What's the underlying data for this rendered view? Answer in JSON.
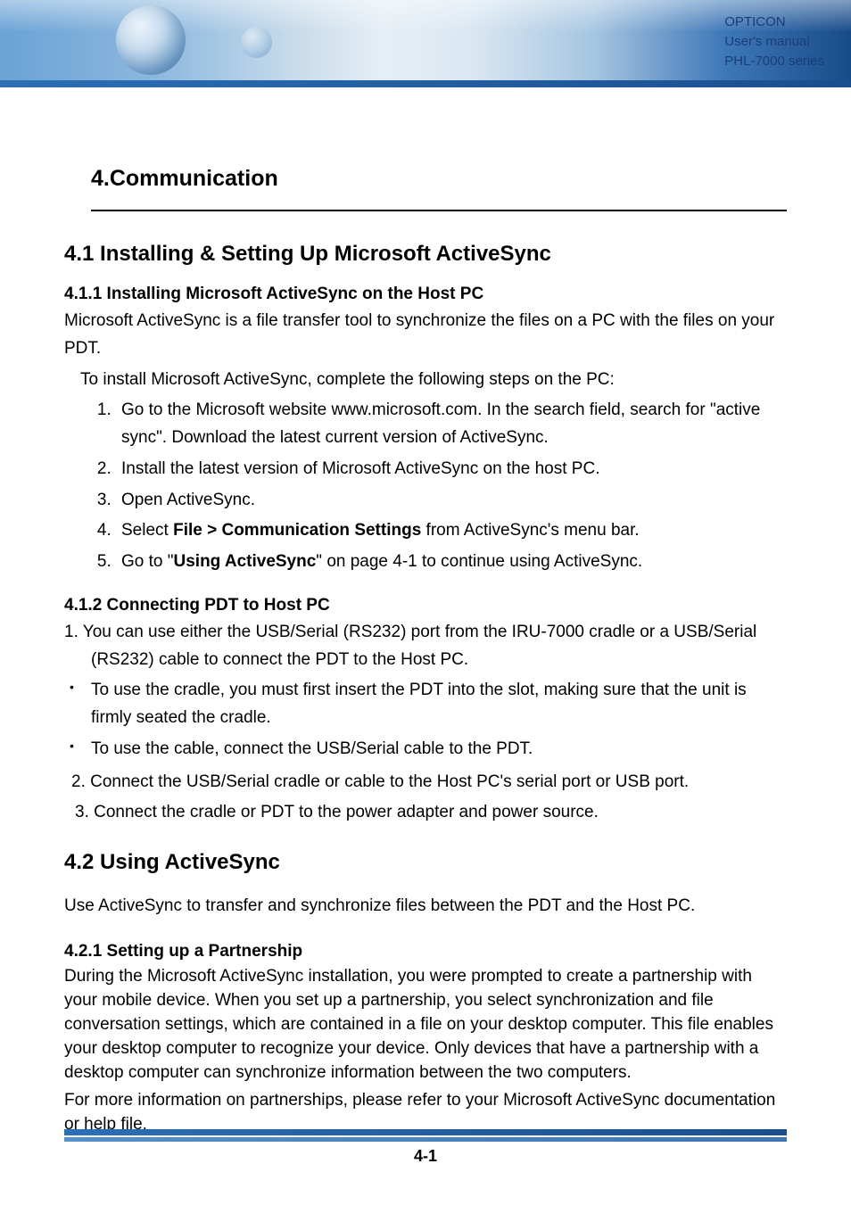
{
  "banner": {
    "line1": "OPTICON",
    "line2": "User's manual",
    "line3": "PHL-7000 series"
  },
  "chapter": {
    "title": "4.Communication"
  },
  "s41": {
    "heading": "4.1 Installing & Setting Up Microsoft ActiveSync",
    "s411": {
      "heading": "4.1.1 Installing Microsoft ActiveSync on the Host PC",
      "para": "Microsoft ActiveSync is a file transfer tool to synchronize the files on a PC with the files on your PDT.",
      "lead": "To install Microsoft ActiveSync, complete the following steps on the PC:",
      "items": [
        "Go to the Microsoft website www.microsoft.com. In the search field, search for \"active sync\". Download the latest current version of ActiveSync.",
        "Install the latest version of Microsoft ActiveSync on the host PC.",
        "Open ActiveSync.",
        "__HTML__Select <b>File > Communication Settings</b> from ActiveSync's menu bar.",
        "__HTML__Go to \"<b>Using ActiveSync</b>\" on page 4-1 to continue using ActiveSync."
      ]
    },
    "s412": {
      "heading": "4.1.2 Connecting PDT to Host PC",
      "step1": "1. You can use either the USB/Serial (RS232) port from the IRU-7000 cradle or a USB/Serial (RS232) cable to connect the PDT to the Host PC.",
      "bullets": [
        "To use the cradle, you must first insert the PDT into the slot, making sure that the unit is firmly seated the cradle.",
        "To use the cable, connect the USB/Serial cable to the PDT."
      ],
      "step2": "2. Connect the USB/Serial cradle or cable to the Host PC's serial port or USB port.",
      "step3": "3. Connect the cradle or PDT to the power adapter and power source."
    }
  },
  "s42": {
    "heading": "4.2 Using ActiveSync",
    "para": "Use ActiveSync to transfer and synchronize files between the PDT and the Host PC.",
    "s421": {
      "heading": "4.2.1 Setting up a Partnership",
      "para1": "During the Microsoft ActiveSync installation, you were prompted to create a partnership with your mobile device. When you set up a partnership, you select synchronization and file conversation settings, which are contained in a file on your desktop computer. This file enables your desktop computer to recognize your device. Only devices that have a partnership with a desktop computer can synchronize information between the two computers.",
      "para2": "For more information on partnerships, please refer to your Microsoft ActiveSync documentation or help file."
    }
  },
  "footer": {
    "page": "4-1"
  }
}
